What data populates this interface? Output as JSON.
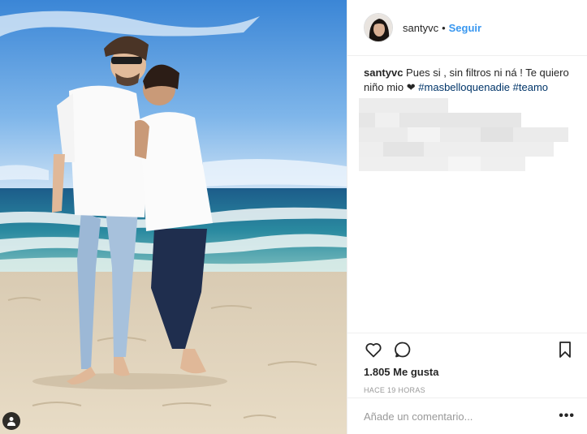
{
  "post": {
    "username": "santyvc",
    "follow_label": "Seguir",
    "separator": "•",
    "caption_text": "Pues si , sin filtros ni ná ! Te quiero niño mio ❤",
    "hashtags": [
      "#masbelloquenadie",
      "#teamo"
    ],
    "likes": "1.805 Me gusta",
    "timestamp": "HACE 19 HORAS",
    "comment_placeholder": "Añade un comentario...",
    "more_label": "•••"
  },
  "icons": {
    "like": "heart-icon",
    "comment": "comment-icon",
    "save": "bookmark-icon",
    "tagged": "tagged-user-icon"
  },
  "colors": {
    "link": "#3897f0",
    "hashtag": "#003569",
    "muted": "#999999",
    "border": "#efefef"
  }
}
